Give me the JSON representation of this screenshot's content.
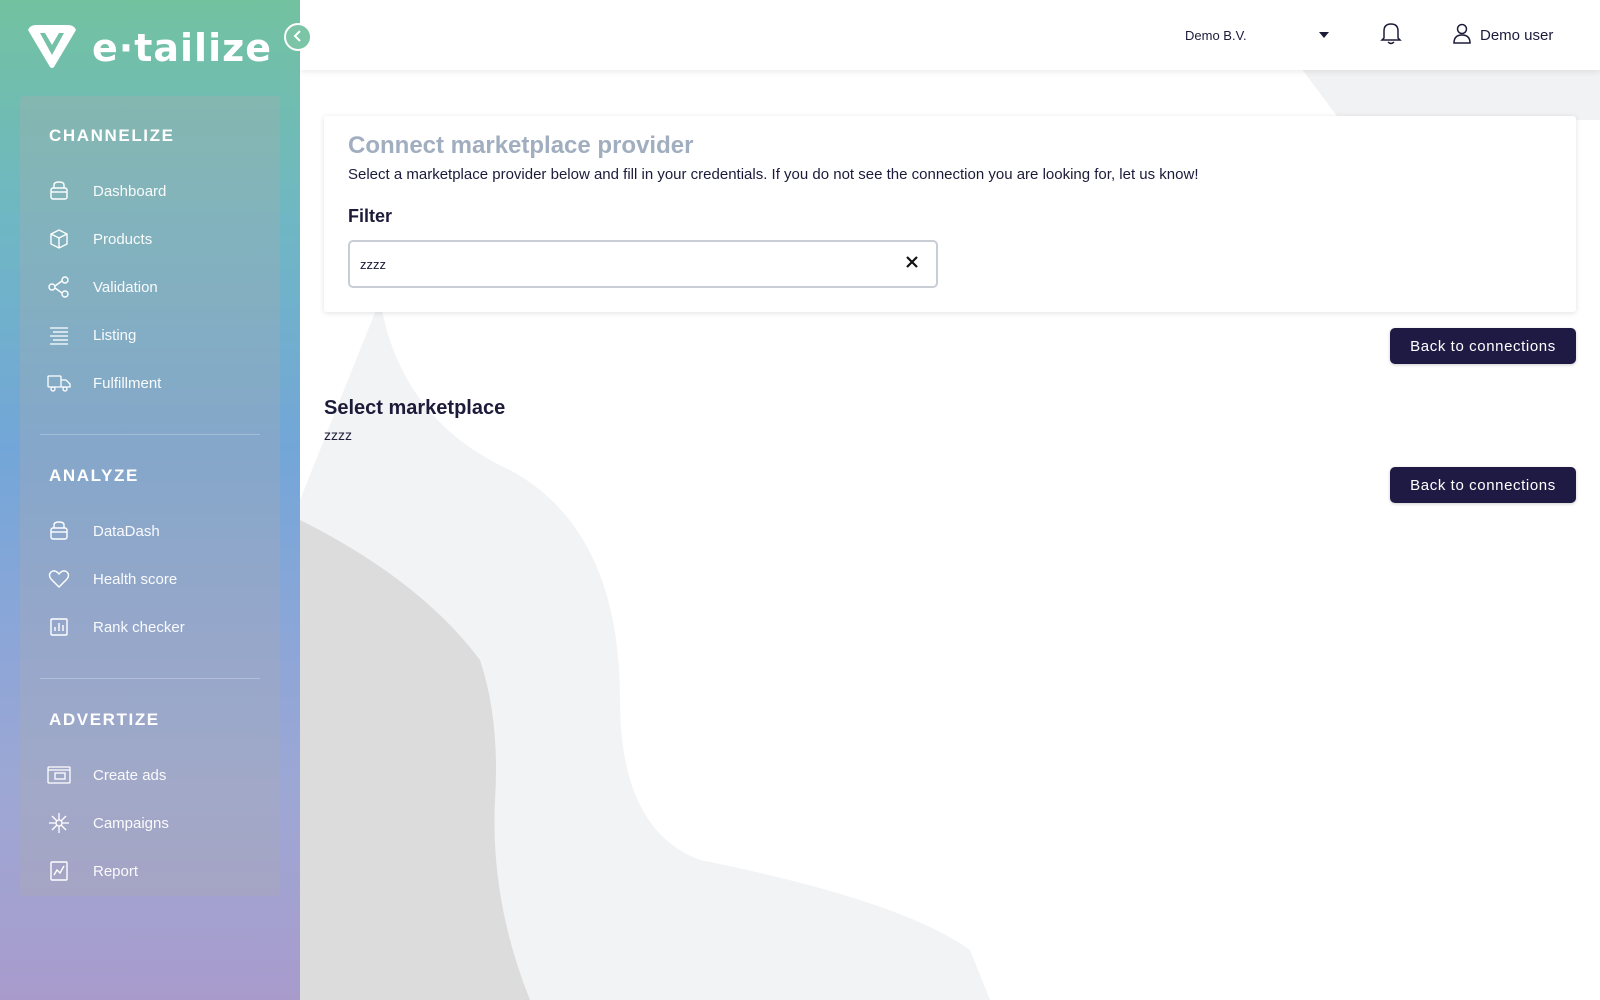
{
  "brand": {
    "name": "e·tailize",
    "logo_icon": "etailize-logo-icon",
    "collapse_icon": "chevron-left-icon"
  },
  "sidebar": {
    "sections": [
      {
        "title": "CHANNELIZE",
        "items": [
          {
            "label": "Dashboard",
            "icon": "basket-icon"
          },
          {
            "label": "Products",
            "icon": "box-icon"
          },
          {
            "label": "Validation",
            "icon": "share-nodes-icon"
          },
          {
            "label": "Listing",
            "icon": "list-lines-icon"
          },
          {
            "label": "Fulfillment",
            "icon": "truck-icon"
          }
        ]
      },
      {
        "title": "ANALYZE",
        "items": [
          {
            "label": "DataDash",
            "icon": "basket-icon"
          },
          {
            "label": "Health score",
            "icon": "heart-icon"
          },
          {
            "label": "Rank checker",
            "icon": "bar-chart-icon"
          }
        ]
      },
      {
        "title": "ADVERTIZE",
        "items": [
          {
            "label": "Create ads",
            "icon": "ads-window-icon"
          },
          {
            "label": "Campaigns",
            "icon": "network-hub-icon"
          },
          {
            "label": "Report",
            "icon": "line-chart-icon"
          }
        ]
      }
    ]
  },
  "topbar": {
    "company": "Demo B.V.",
    "company_dropdown_icon": "caret-down-icon",
    "notification_icon": "bell-icon",
    "user_icon": "user-icon",
    "user_name": "Demo user"
  },
  "card": {
    "title": "Connect marketplace provider",
    "description": "Select a marketplace provider below and fill in your credentials. If you do not see the connection you are looking for, let us know!",
    "filter_label": "Filter",
    "filter_value": "zzzz",
    "clear_icon": "close-icon"
  },
  "actions": {
    "back_label": "Back to connections"
  },
  "marketplace": {
    "title": "Select marketplace",
    "subtitle": "zzzz"
  },
  "colors": {
    "primary_button": "#1f1a44",
    "card_title": "#a1aec0",
    "sidebar_top": "#72c2a0",
    "sidebar_bottom": "#a89bcc"
  }
}
